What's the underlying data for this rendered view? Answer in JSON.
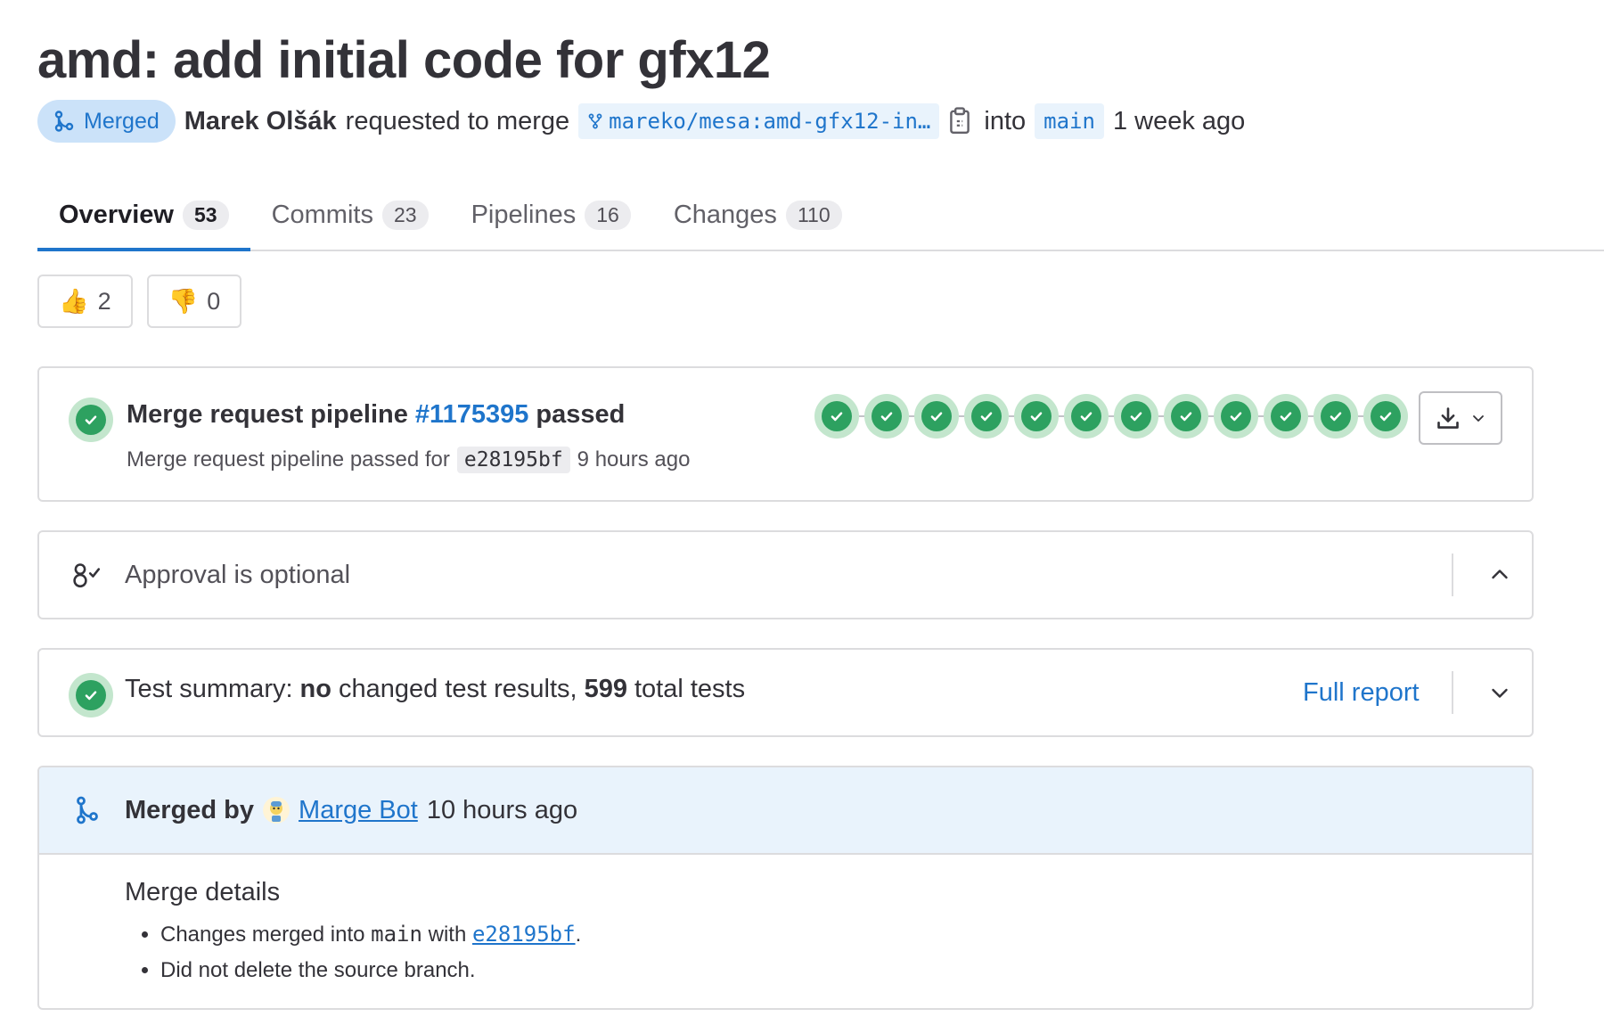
{
  "title": "amd: add initial code for gfx12",
  "meta": {
    "status_label": "Merged",
    "author": "Marek Olšák",
    "requested_text": "requested to merge",
    "source_branch": "mareko/mesa:amd-gfx12-in…",
    "into_text": "into",
    "target_branch": "main",
    "time": "1 week ago"
  },
  "tabs": [
    {
      "label": "Overview",
      "count": "53"
    },
    {
      "label": "Commits",
      "count": "23"
    },
    {
      "label": "Pipelines",
      "count": "16"
    },
    {
      "label": "Changes",
      "count": "110"
    }
  ],
  "reactions": {
    "thumbs_up": "2",
    "thumbs_down": "0"
  },
  "pipeline": {
    "title_prefix": "Merge request pipeline",
    "id": "#1175395",
    "status": "passed",
    "subtitle": "Merge request pipeline passed for",
    "sha": "e28195bf",
    "time": "9 hours ago",
    "stage_count": 12
  },
  "approval": {
    "text": "Approval is optional"
  },
  "tests": {
    "prefix": "Test summary:",
    "changed": "no",
    "middle": "changed test results,",
    "total": "599",
    "suffix": "total tests",
    "full_report": "Full report"
  },
  "merged": {
    "by_label": "Merged by",
    "user": "Marge Bot",
    "time": "10 hours ago",
    "details_title": "Merge details",
    "line1_prefix": "Changes merged into",
    "line1_branch": "main",
    "line1_with": "with",
    "line1_sha": "e28195bf",
    "line1_end": ".",
    "line2": "Did not delete the source branch."
  },
  "colors": {
    "accent": "#1f75cb",
    "success": "#2da160",
    "merged_badge_bg": "#cbe2f9",
    "merged_header_bg": "#e9f3fc"
  }
}
